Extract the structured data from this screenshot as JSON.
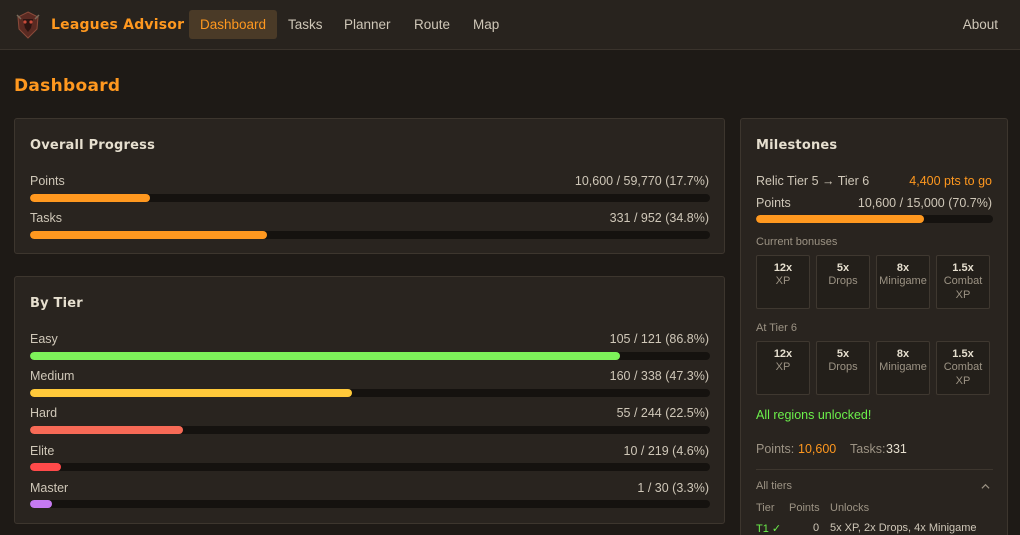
{
  "app": {
    "brand": "Leagues Advisor",
    "nav": [
      "Dashboard",
      "Tasks",
      "Planner",
      "Route",
      "Map"
    ],
    "about": "About"
  },
  "page": {
    "title": "Dashboard"
  },
  "overall": {
    "title": "Overall Progress",
    "rows": [
      {
        "label": "Points",
        "value": "10,600 / 59,770 (17.7%)",
        "fraction": 0.177,
        "color": "#ff981f"
      },
      {
        "label": "Tasks",
        "value": "331 / 952 (34.8%)",
        "fraction": 0.348,
        "color": "#ff981f"
      }
    ]
  },
  "by_tier": {
    "title": "By Tier",
    "rows": [
      {
        "label": "Easy",
        "value": "105 / 121 (86.8%)",
        "fraction": 0.868,
        "color": "#7df25a"
      },
      {
        "label": "Medium",
        "value": "160 / 338 (47.3%)",
        "fraction": 0.473,
        "color": "#ffc93a"
      },
      {
        "label": "Hard",
        "value": "55 / 244 (22.5%)",
        "fraction": 0.225,
        "color": "#f76a56"
      },
      {
        "label": "Elite",
        "value": "10 / 219 (4.6%)",
        "fraction": 0.046,
        "color": "#ff4a4a"
      },
      {
        "label": "Master",
        "value": "1 / 30 (3.3%)",
        "fraction": 0.033,
        "color": "#c77af2"
      }
    ]
  },
  "milestones": {
    "title": "Milestones",
    "relic_label": "Relic Tier 5 → Tier 6",
    "relic_to_go": "4,400 pts to go",
    "points_label": "Points",
    "points_value": "10,600 / 15,000 (70.7%)",
    "points_fraction": 0.707,
    "current_label": "Current bonuses",
    "current_bonuses": [
      {
        "mult": "12x",
        "name": "XP"
      },
      {
        "mult": "5x",
        "name": "Drops"
      },
      {
        "mult": "8x",
        "name": "Minigame"
      },
      {
        "mult": "1.5x",
        "name": "Combat XP"
      }
    ],
    "next_label": "At Tier 6",
    "next_bonuses": [
      {
        "mult": "12x",
        "name": "XP"
      },
      {
        "mult": "5x",
        "name": "Drops"
      },
      {
        "mult": "8x",
        "name": "Minigame"
      },
      {
        "mult": "1.5x",
        "name": "Combat XP"
      }
    ],
    "regions": "All regions unlocked!",
    "summary_points_label": "Points:",
    "summary_points_value": "10,600",
    "summary_tasks_label": "Tasks:",
    "summary_tasks_value": "331",
    "all_tiers_label": "All tiers",
    "table_headers": [
      "Tier",
      "Points",
      "Unlocks"
    ],
    "table_rows": [
      {
        "tier": "T1 ✓",
        "points": "0",
        "unlocks": "5x XP, 2x Drops, 4x Minigame"
      }
    ]
  }
}
